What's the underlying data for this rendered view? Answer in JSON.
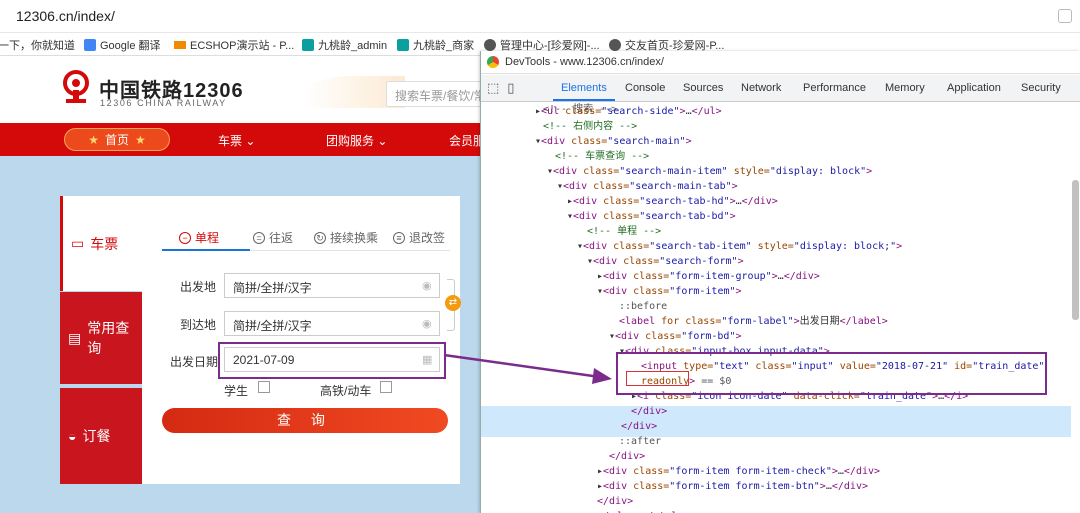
{
  "browser": {
    "url": "12306.cn/index/",
    "bookmarks": [
      {
        "label": "一下，你就知道",
        "icon": "paw-icon",
        "color": "#2f6bd7"
      },
      {
        "label": "Google 翻译",
        "icon": "translate-icon",
        "color": "#4285f4"
      },
      {
        "label": "ECSHOP演示站 - P...",
        "icon": "cart-icon",
        "color": "#f08a00"
      },
      {
        "label": "九桃龄_admin",
        "icon": "site-icon",
        "color": "#0aa0a0"
      },
      {
        "label": "九桃龄_商家",
        "icon": "site-icon",
        "color": "#0aa0a0"
      },
      {
        "label": "管理中心-[珍爱网]-...",
        "icon": "globe-icon",
        "color": "#555555"
      },
      {
        "label": "交友首页-珍爱网-P...",
        "icon": "globe-icon",
        "color": "#555555"
      }
    ]
  },
  "site": {
    "logo_cn": "中国铁路12306",
    "logo_en": "12306 CHINA RAILWAY",
    "search_placeholder": "搜索车票/餐饮/常",
    "nav": {
      "home": "首页",
      "tickets": "车票",
      "group": "团购服务",
      "member": "会员服"
    },
    "left_tabs": {
      "tickets": "车票",
      "common": "常用查询",
      "order": "订餐"
    },
    "form_tabs": {
      "oneway": "单程",
      "roundtrip": "往返",
      "transfer": "接续换乘",
      "refund": "退改签"
    },
    "labels": {
      "from": "出发地",
      "to": "到达地",
      "date": "出发日期",
      "student": "学生",
      "highspeed": "高铁/动车"
    },
    "inputs": {
      "from": "简拼/全拼/汉字",
      "to": "简拼/全拼/汉字",
      "date": "2021-07-09"
    },
    "query_button": "查 询",
    "colors": {
      "red": "#d40a0a",
      "sky": "#bcd8ec",
      "highlight": "#7b2b8c"
    }
  },
  "devtools": {
    "title": "DevTools - www.12306.cn/index/",
    "tabs": [
      "Elements",
      "Console",
      "Sources",
      "Network",
      "Performance",
      "Memory",
      "Application",
      "Security"
    ],
    "active_tab": "Elements"
  }
}
